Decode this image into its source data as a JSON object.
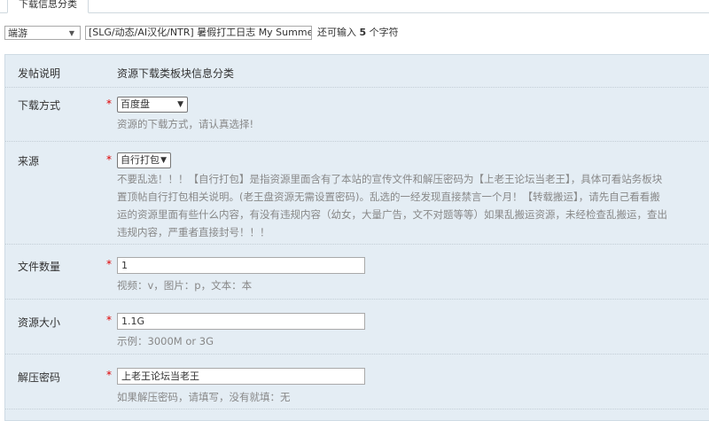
{
  "tab": {
    "label": "下载信息分类"
  },
  "title_bar": {
    "category_value": "端游",
    "title_value": "[SLG/动态/AI汉化/NTR] 暑假打工日志 My Summer Job v",
    "remaining_prefix": "还可输入",
    "remaining_count": "5",
    "remaining_suffix": "个字符"
  },
  "form": {
    "post_note": {
      "label": "发帖说明",
      "value": "资源下载类板块信息分类"
    },
    "download_method": {
      "label": "下载方式",
      "required": "*",
      "value": "百度盘",
      "hint": "资源的下载方式，请认真选择!"
    },
    "source": {
      "label": "来源",
      "required": "*",
      "value": "自行打包",
      "hint_lines": [
        "不要乱选！！！【自行打包】是指资源里面含有了本站的宣传文件和解压密码为【上老王论坛当老王】，具体可看站务板块",
        "置顶帖自行打包相关说明。(老王盘资源无需设置密码)。乱选的一经发现直接禁言一个月！【转载搬运】，请先自己看看搬",
        "运的资源里面有些什么内容，有没有违规内容（幼女，大量广告，文不对题等等）如果乱搬运资源，未经检查乱搬运，查出",
        "违规内容，严重者直接封号！！！"
      ]
    },
    "file_count": {
      "label": "文件数量",
      "required": "*",
      "value": "1",
      "hint": "视频：v，图片：p，文本：本"
    },
    "resource_size": {
      "label": "资源大小",
      "required": "*",
      "value": "1.1G",
      "hint": "示例：3000M or 3G"
    },
    "unzip_password": {
      "label": "解压密码",
      "required": "*",
      "value": "上老王论坛当老王",
      "hint": "如果解压密码，请填写，没有就填：无"
    }
  }
}
